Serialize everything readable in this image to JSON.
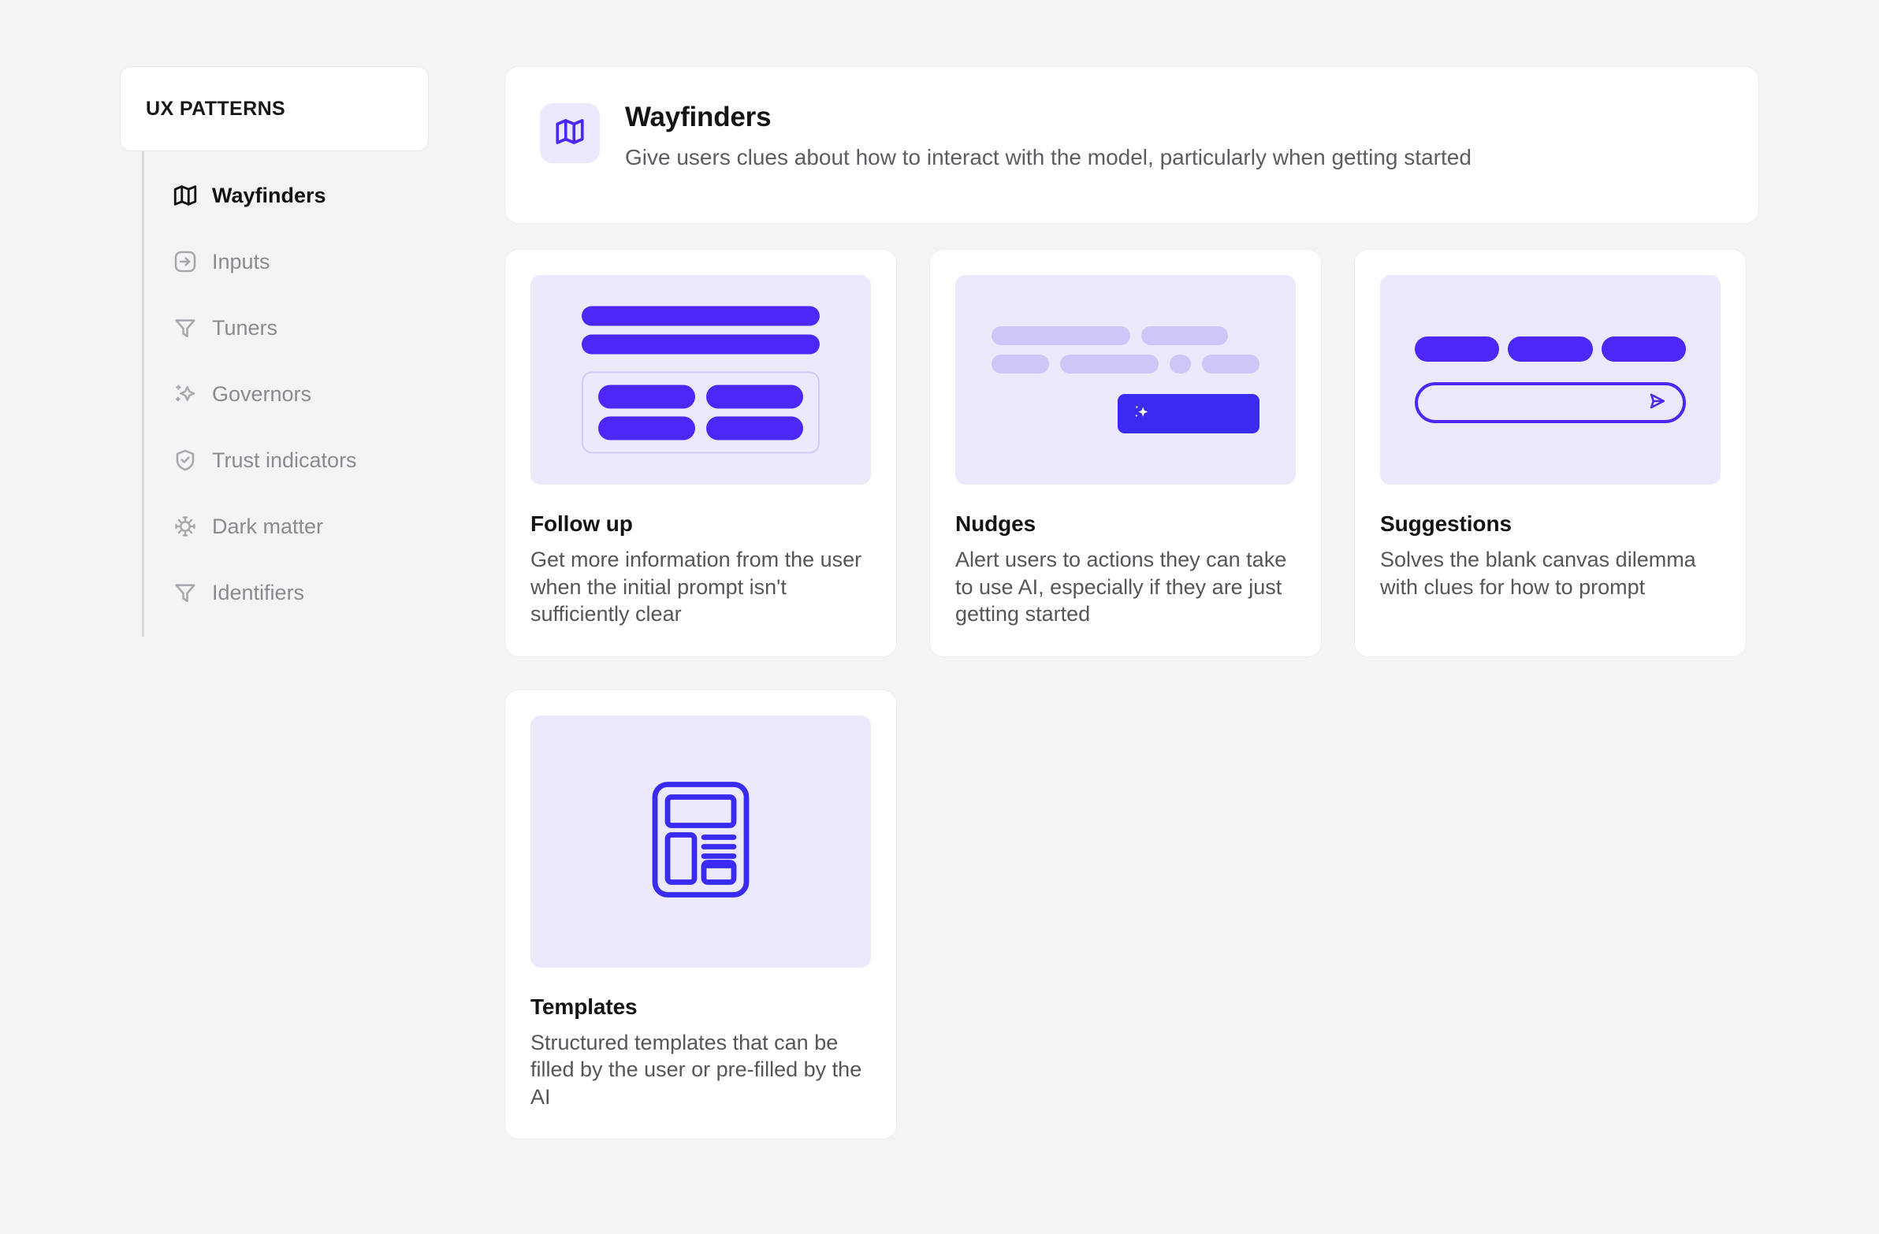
{
  "sidebar": {
    "header_title": "UX PATTERNS",
    "items": [
      {
        "label": "Wayfinders",
        "icon": "map-icon",
        "active": true
      },
      {
        "label": "Inputs",
        "icon": "arrow-into-box-icon",
        "active": false
      },
      {
        "label": "Tuners",
        "icon": "funnel-icon",
        "active": false
      },
      {
        "label": "Governors",
        "icon": "sparkle-icon",
        "active": false
      },
      {
        "label": "Trust indicators",
        "icon": "shield-check-icon",
        "active": false
      },
      {
        "label": "Dark matter",
        "icon": "virus-icon",
        "active": false
      },
      {
        "label": "Identifiers",
        "icon": "funnel-icon",
        "active": false
      }
    ]
  },
  "hero": {
    "icon": "map-icon",
    "title": "Wayfinders",
    "description": "Give users clues about how to interact with the model, particularly when getting started"
  },
  "cards": [
    {
      "title": "Follow up",
      "description": "Get more information from the user when the initial prompt isn't sufficiently clear",
      "illustration": "follow-up-illustration"
    },
    {
      "title": "Nudges",
      "description": "Alert users to actions they can take to use AI, especially if they are just getting started",
      "illustration": "nudges-illustration"
    },
    {
      "title": "Suggestions",
      "description": "Solves the blank canvas dilemma with clues for how to prompt",
      "illustration": "suggestions-illustration"
    },
    {
      "title": "Templates",
      "description": "Structured templates that can be filled by the user or pre-filled by the AI",
      "illustration": "templates-illustration"
    }
  ],
  "colors": {
    "accent": "#4c27f5",
    "accent_button": "#3b2bf0",
    "thumb_background": "#ebe9fb",
    "skeleton": "#cdc6f6",
    "page_background": "#f4f4f5",
    "card_background": "#ffffff",
    "card_border": "#ededef",
    "text_primary": "#141417",
    "text_muted": "#55555c",
    "nav_muted": "#8a8a90"
  }
}
